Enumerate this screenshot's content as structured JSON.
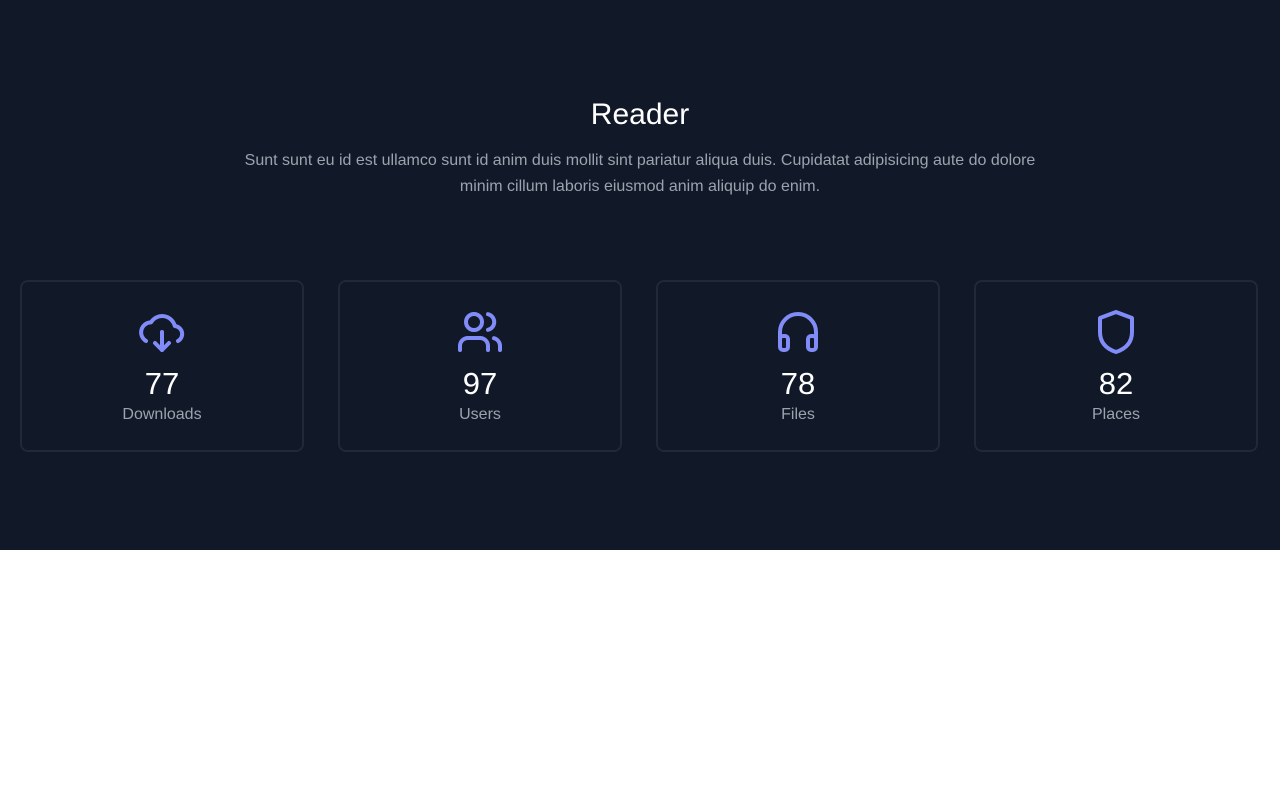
{
  "hero": {
    "title": "Reader",
    "description": "Sunt sunt eu id est ullamco sunt id anim duis mollit sint pariatur aliqua duis. Cupidatat adipisicing aute do dolore minim cillum laboris eiusmod anim aliquip do enim."
  },
  "stats": [
    {
      "value": "77",
      "label": "Downloads",
      "icon": "cloud-download-icon"
    },
    {
      "value": "97",
      "label": "Users",
      "icon": "users-icon"
    },
    {
      "value": "78",
      "label": "Files",
      "icon": "headphones-icon"
    },
    {
      "value": "82",
      "label": "Places",
      "icon": "shield-icon"
    }
  ],
  "colors": {
    "background": "#111827",
    "accent": "#818cf8",
    "muted_text": "#9ca3af",
    "card_border": "#1f2937"
  }
}
